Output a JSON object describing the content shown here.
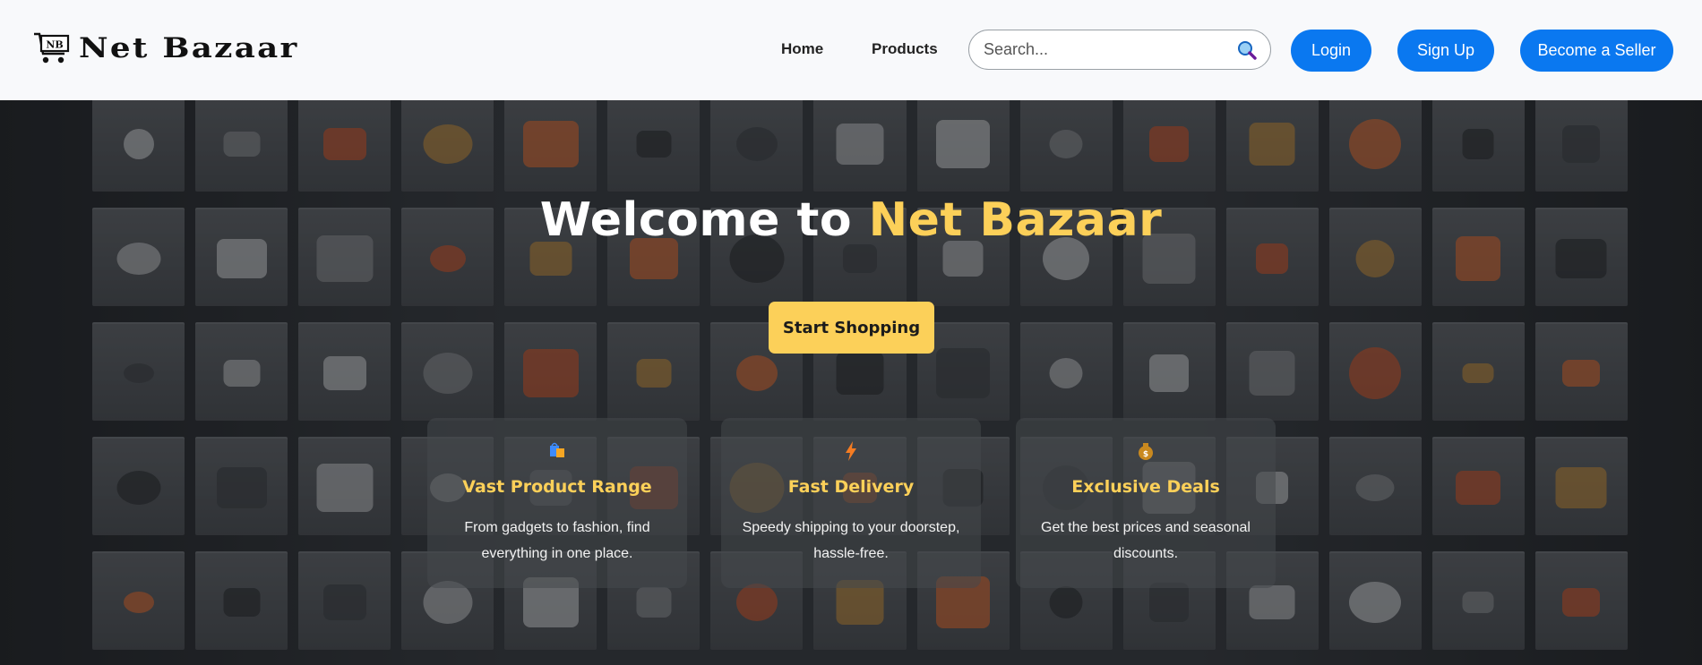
{
  "brand": {
    "logo_mark": "NB",
    "name": "Net Bazaar",
    "icon": "shopping-cart-icon"
  },
  "nav": {
    "home": "Home",
    "products": "Products"
  },
  "search": {
    "placeholder": "Search...",
    "icon": "search-icon"
  },
  "auth": {
    "login": "Login",
    "signup": "Sign Up",
    "seller": "Become a Seller"
  },
  "colors": {
    "primary": "#0a78f0",
    "accent": "#fcd059",
    "header_bg": "#f8f9fb"
  },
  "hero": {
    "title_prefix": "Welcome to ",
    "title_accent": "Net Bazaar",
    "cta": "Start Shopping"
  },
  "features": [
    {
      "icon": "shopping-bags-icon",
      "title": "Vast Product Range",
      "desc": "From gadgets to fashion, find everything in one place."
    },
    {
      "icon": "lightning-icon",
      "title": "Fast Delivery",
      "desc": "Speedy shipping to your doorstep, hassle-free."
    },
    {
      "icon": "money-bag-icon",
      "title": "Exclusive Deals",
      "desc": "Get the best prices and seasonal discounts."
    }
  ]
}
